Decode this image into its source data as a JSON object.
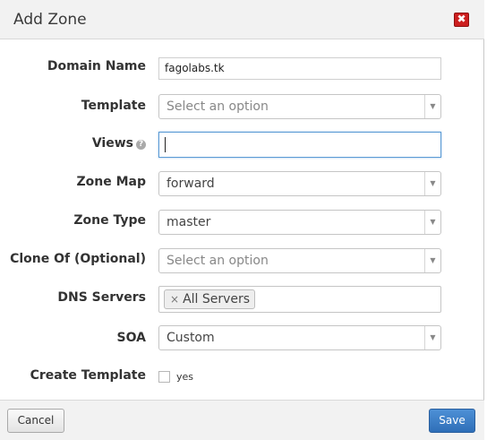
{
  "dialog": {
    "title": "Add Zone",
    "close_icon": "close-icon",
    "close_glyph": "✖"
  },
  "form": {
    "domain_name": {
      "label": "Domain Name",
      "value": "fagolabs.tk"
    },
    "template": {
      "label": "Template",
      "placeholder": "Select an option"
    },
    "views": {
      "label": "Views",
      "value": "",
      "help_icon": "question-circle-icon"
    },
    "zone_map": {
      "label": "Zone Map",
      "value": "forward"
    },
    "zone_type": {
      "label": "Zone Type",
      "value": "master"
    },
    "clone_of": {
      "label": "Clone Of (Optional)",
      "placeholder": "Select an option"
    },
    "dns_servers": {
      "label": "DNS Servers",
      "tags": [
        "All Servers"
      ],
      "tag_remove_glyph": "×"
    },
    "soa": {
      "label": "SOA",
      "value": "Custom"
    },
    "create_template": {
      "label": "Create Template",
      "checkbox_label": "yes",
      "checked": false
    }
  },
  "footer": {
    "cancel_label": "Cancel",
    "save_label": "Save"
  },
  "colors": {
    "close_button": "#cc1f1f",
    "save_button": "#3a7bc8",
    "focus_border": "#5b9bd5"
  }
}
